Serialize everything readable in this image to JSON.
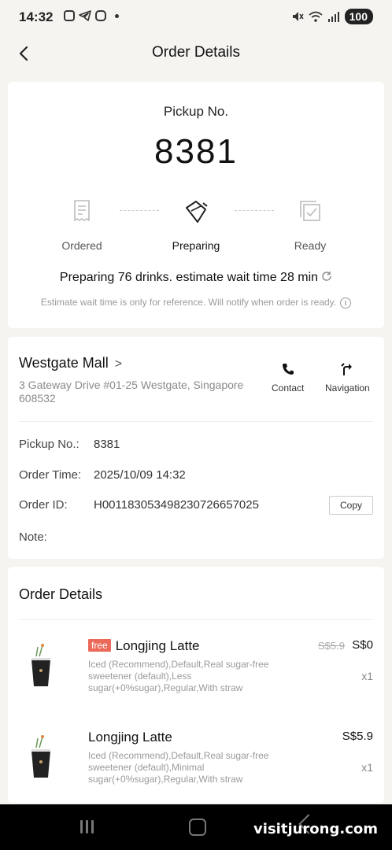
{
  "status_bar": {
    "time": "14:32",
    "battery": "100"
  },
  "header": {
    "title": "Order Details"
  },
  "pickup": {
    "label": "Pickup No.",
    "number": "8381",
    "steps": [
      "Ordered",
      "Preparing",
      "Ready"
    ],
    "active_step": "Preparing",
    "status_text": "Preparing 76 drinks. estimate wait time 28 min",
    "note": "Estimate wait time is only for reference. Will notify when order is ready."
  },
  "store": {
    "name": "Westgate Mall",
    "address": "3 Gateway Drive #01-25 Westgate, Singapore 608532",
    "contact_label": "Contact",
    "navigation_label": "Navigation"
  },
  "order_info": {
    "pickup_key": "Pickup No.:",
    "pickup_val": "8381",
    "time_key": "Order Time:",
    "time_val": "2025/10/09 14:32",
    "id_key": "Order ID:",
    "id_val": "H001183053498230726657025",
    "copy_label": "Copy",
    "note_key": "Note:"
  },
  "order_details": {
    "title": "Order Details",
    "items": [
      {
        "badge": "free",
        "name": "Longjing Latte",
        "desc": "Iced (Recommend),Default,Real sugar-free sweetener (default),Less sugar(+0%sugar),Regular,With straw",
        "original_price": "S$5.9",
        "price": "S$0",
        "qty": "x1"
      },
      {
        "name": "Longjing Latte",
        "desc": "Iced (Recommend),Default,Real sugar-free sweetener (default),Minimal sugar(+0%sugar),Regular,With straw",
        "price": "S$5.9",
        "qty": "x1"
      }
    ]
  },
  "watermark": "visitjurong.com",
  "colors": {
    "accent_free": "#ec6a5a",
    "background": "#f5f4f0"
  },
  "icons": [
    "back-arrow-icon",
    "receipt-icon",
    "cup-pour-icon",
    "checkbox-stack-icon",
    "refresh-icon",
    "info-icon",
    "chevron-right-icon",
    "phone-icon",
    "navigation-arrow-icon"
  ]
}
